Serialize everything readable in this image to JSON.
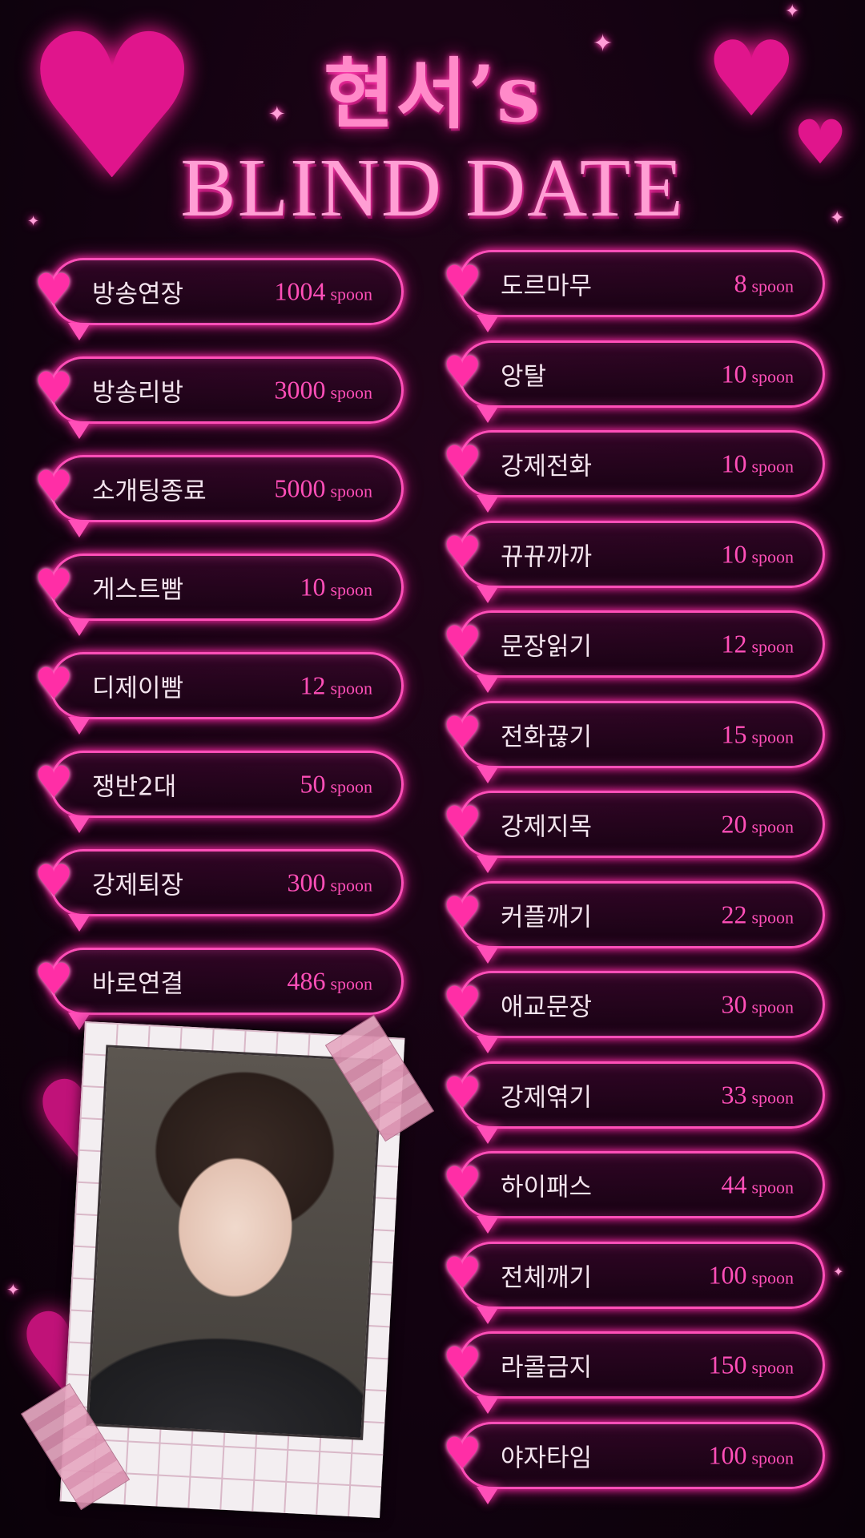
{
  "title": {
    "top": "현서’s",
    "bottom": "BLIND DATE"
  },
  "unit": "spoon",
  "menu_left": [
    {
      "name": "방송연장",
      "price": "1004"
    },
    {
      "name": "방송리방",
      "price": "3000"
    },
    {
      "name": "소개팅종료",
      "price": "5000"
    },
    {
      "name": "게스트빰",
      "price": "10"
    },
    {
      "name": "디제이빰",
      "price": "12"
    },
    {
      "name": "쟁반2대",
      "price": "50"
    },
    {
      "name": "강제퇴장",
      "price": "300"
    },
    {
      "name": "바로연결",
      "price": "486"
    }
  ],
  "menu_right": [
    {
      "name": "도르마무",
      "price": "8"
    },
    {
      "name": "앙탈",
      "price": "10"
    },
    {
      "name": "강제전화",
      "price": "10"
    },
    {
      "name": "뀨뀨까까",
      "price": "10"
    },
    {
      "name": "문장읽기",
      "price": "12"
    },
    {
      "name": "전화끊기",
      "price": "15"
    },
    {
      "name": "강제지목",
      "price": "20"
    },
    {
      "name": "커플깨기",
      "price": "22"
    },
    {
      "name": "애교문장",
      "price": "30"
    },
    {
      "name": "강제엮기",
      "price": "33"
    },
    {
      "name": "하이패스",
      "price": "44"
    },
    {
      "name": "전체깨기",
      "price": "100"
    },
    {
      "name": "라콜금지",
      "price": "150"
    },
    {
      "name": "야자타임",
      "price": "100"
    }
  ],
  "colors": {
    "accent": "#ff4fb8",
    "heart": "#ff2ea6",
    "background": "#120210",
    "label": "#f3e4ee"
  },
  "icons": [
    "heart-icon",
    "sparkle-icon"
  ]
}
